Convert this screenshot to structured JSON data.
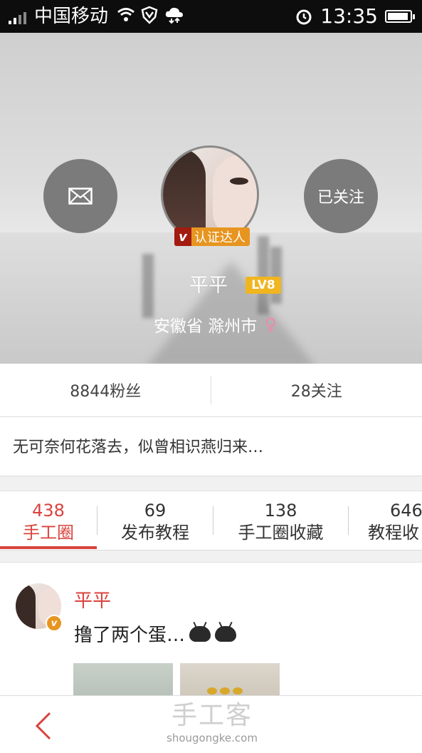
{
  "status_bar": {
    "carrier": "中国移动",
    "time": "13:35",
    "battery_level": 0.85
  },
  "profile": {
    "message_button_icon": "envelope-icon",
    "follow_button_label": "已关注",
    "badge_v": "v",
    "badge_text": "认证达人",
    "name": "平平",
    "level": "LV8",
    "location": "安徽省 滁州市",
    "gender_icon": "♀"
  },
  "stats": {
    "followers": "8844粉丝",
    "following": "28关注"
  },
  "bio": "无可奈何花落去，似曾相识燕归来…",
  "tabs": [
    {
      "count": "438",
      "label": "手工圈"
    },
    {
      "count": "69",
      "label": "发布教程"
    },
    {
      "count": "138",
      "label": "手工圈收藏"
    },
    {
      "count": "646",
      "label": "教程收"
    }
  ],
  "post": {
    "author": "平平",
    "badge_v": "v",
    "text": "撸了两个蛋…"
  },
  "bottom": {
    "watermark_big": "手工客",
    "watermark_small": "shougongke.com"
  },
  "colors": {
    "accent": "#d9433e",
    "badge_orange": "#e79520",
    "badge_red": "#a31b10",
    "level_yellow": "#f0b51f"
  }
}
